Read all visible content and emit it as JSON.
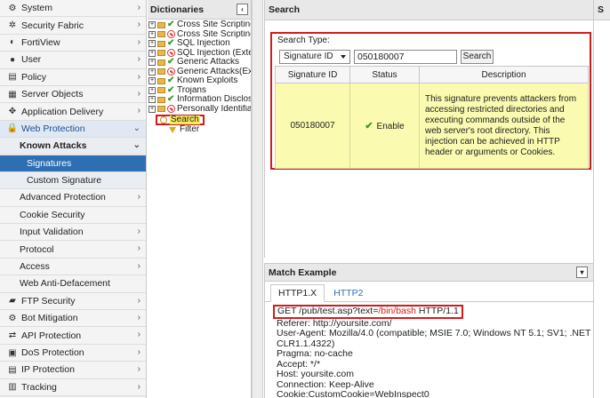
{
  "nav": {
    "items": [
      {
        "icon": "gear-icon",
        "glyph": "⚙",
        "label": "System",
        "chev": "›"
      },
      {
        "icon": "fabric-icon",
        "glyph": "✲",
        "label": "Security Fabric",
        "chev": "›"
      },
      {
        "icon": "fortiview-icon",
        "glyph": "◐",
        "label": "FortiView",
        "chev": "›"
      },
      {
        "icon": "user-icon",
        "glyph": "●",
        "label": "User",
        "chev": "›"
      },
      {
        "icon": "policy-icon",
        "glyph": "▤",
        "label": "Policy",
        "chev": "›"
      },
      {
        "icon": "server-icon",
        "glyph": "▦",
        "label": "Server Objects",
        "chev": "›"
      },
      {
        "icon": "delivery-icon",
        "glyph": "✥",
        "label": "Application Delivery",
        "chev": "›"
      },
      {
        "icon": "lock-icon",
        "glyph": "🔒",
        "label": "Web Protection",
        "chev": "⌄"
      }
    ],
    "known_attacks": "Known Attacks",
    "known_attacks_chev": "⌄",
    "signatures": "Signatures",
    "custom_signature": "Custom Signature",
    "sub_items": [
      {
        "label": "Advanced Protection",
        "chev": "›"
      },
      {
        "label": "Cookie Security",
        "chev": ""
      },
      {
        "label": "Input Validation",
        "chev": "›"
      },
      {
        "label": "Protocol",
        "chev": "›"
      },
      {
        "label": "Access",
        "chev": "›"
      },
      {
        "label": "Web Anti-Defacement",
        "chev": ""
      }
    ],
    "bottom_items": [
      {
        "icon": "ftp-icon",
        "glyph": "▰",
        "label": "FTP Security",
        "chev": "›"
      },
      {
        "icon": "bot-icon",
        "glyph": "⚙",
        "label": "Bot Mitigation",
        "chev": "›"
      },
      {
        "icon": "api-icon",
        "glyph": "⇄",
        "label": "API Protection",
        "chev": "›"
      },
      {
        "icon": "dos-icon",
        "glyph": "▣",
        "label": "DoS Protection",
        "chev": "›"
      },
      {
        "icon": "ip-icon",
        "glyph": "▤",
        "label": "IP Protection",
        "chev": "›"
      },
      {
        "icon": "tracking-icon",
        "glyph": "▥",
        "label": "Tracking",
        "chev": "›"
      }
    ]
  },
  "dictionaries": {
    "title": "Dictionaries",
    "collapse_glyph": "‹",
    "tree": [
      {
        "status": "check",
        "label": "Cross Site Scripting"
      },
      {
        "status": "no",
        "label": "Cross Site Scripting"
      },
      {
        "status": "check",
        "label": "SQL Injection"
      },
      {
        "status": "no",
        "label": "SQL Injection (Exte"
      },
      {
        "status": "check",
        "label": "Generic Attacks"
      },
      {
        "status": "no",
        "label": "Generic Attacks(Ex"
      },
      {
        "status": "check",
        "label": "Known Exploits"
      },
      {
        "status": "check",
        "label": "Trojans"
      },
      {
        "status": "check",
        "label": "Information Disclos"
      },
      {
        "status": "no",
        "label": "Personally Identifia"
      }
    ],
    "search_label": "Search",
    "filter_label": "Filter"
  },
  "search": {
    "panel_title": "Search",
    "type_label": "Search Type:",
    "type_value": "Signature ID",
    "query_value": "050180007",
    "button_label": "Search",
    "columns": [
      "Signature ID",
      "Status",
      "Description"
    ],
    "result": {
      "id": "050180007",
      "status": "Enable",
      "description": "This signature prevents attackers from accessing restricted directories and executing commands outside of the web server's root directory. This injection can be achieved in HTTP header or arguments or Cookies."
    }
  },
  "match": {
    "title": "Match Example",
    "tabs": [
      "HTTP1.X",
      "HTTP2"
    ],
    "req_prefix": "GET /pub/test.asp?text=",
    "req_highlight": "/bin/bash",
    "req_suffix": " HTTP/1.1",
    "lines": [
      "Referer: http://yoursite.com/",
      "User-Agent: Mozilla/4.0 (compatible; MSIE 7.0; Windows NT 5.1; SV1; .NET",
      "CLR1.1.4322)",
      "Pragma: no-cache",
      "Accept: */*",
      "Host: yoursite.com",
      "Connection: Keep-Alive",
      "Cookie:CustomCookie=WebInspect0"
    ]
  },
  "right_strip": {
    "title": "S"
  }
}
